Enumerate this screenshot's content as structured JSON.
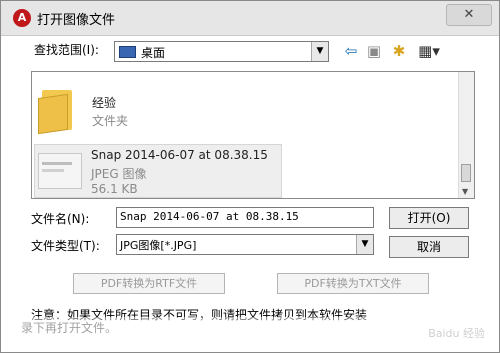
{
  "window": {
    "title": "打开图像文件",
    "close_label": "✕",
    "app_icon": "A"
  },
  "lookin": {
    "label": "查找范围(I):",
    "value": "桌面",
    "icon": "desktop-icon",
    "dropdown_arrow": "▼"
  },
  "toolbar": {
    "back_icon": "⇦",
    "up_icon": "▣",
    "new_folder_icon": "✱",
    "view_icon": "▦▾"
  },
  "files": {
    "folder": {
      "name": "经验",
      "type": "文件夹"
    },
    "image": {
      "name": "Snap 2014-06-07 at 08.38.15",
      "type": "JPEG 图像",
      "size": "56.1 KB"
    }
  },
  "filename": {
    "label": "文件名(N):",
    "value": "Snap 2014-06-07 at 08.38.15"
  },
  "filetype": {
    "label": "文件类型(T):",
    "value": "JPG图像[*.JPG]",
    "dropdown_arrow": "▼"
  },
  "buttons": {
    "open": "打开(O)",
    "cancel": "取消",
    "pdf_rtf": "PDF转换为RTF文件",
    "pdf_txt": "PDF转换为TXT文件"
  },
  "note": {
    "line1": "注意：如果文件所在目录不可写，则请把文件拷贝到本软件安装",
    "line2": "录下再打开文件。",
    "watermark": "Baidu 经验"
  }
}
